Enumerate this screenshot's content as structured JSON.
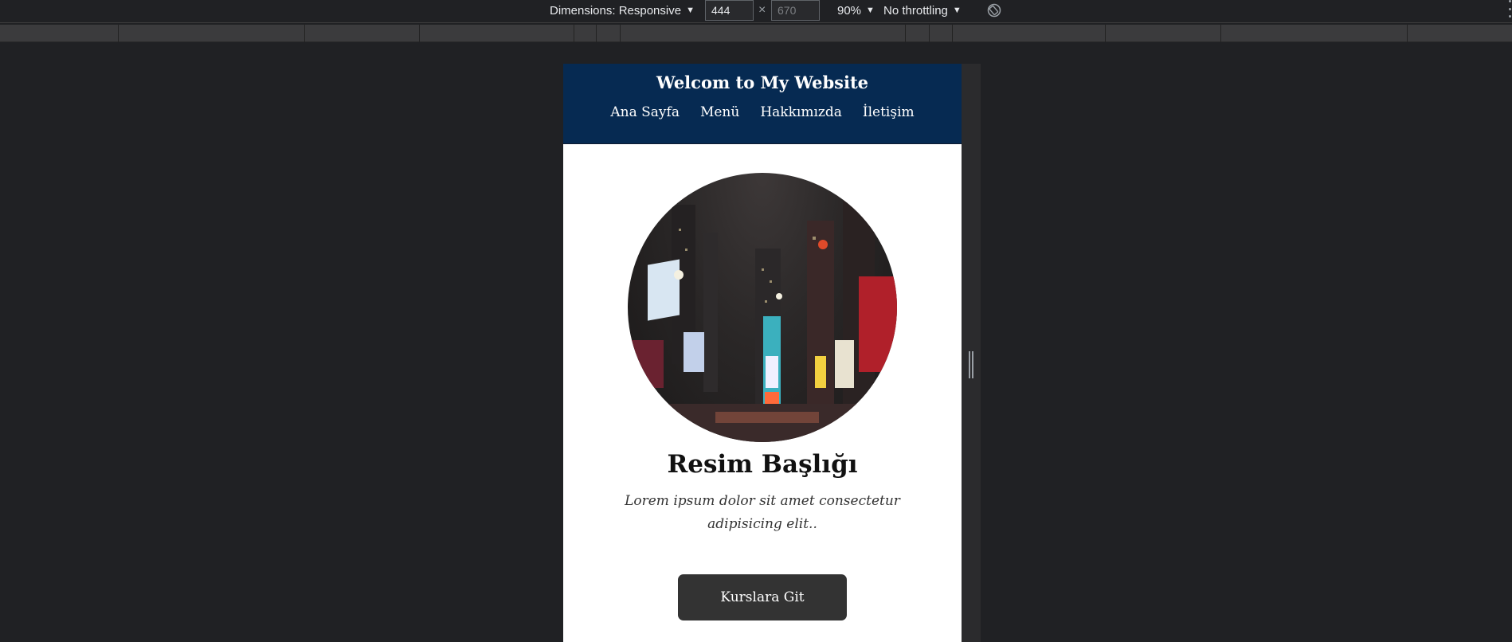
{
  "devtools": {
    "dimensions_label": "Dimensions: Responsive",
    "width_value": "444",
    "height_placeholder": "670",
    "times": "×",
    "zoom_label": "90%",
    "throttling_label": "No throttling",
    "caret": "▼"
  },
  "site": {
    "title": "Welcom to My Website",
    "nav": [
      "Ana Sayfa",
      "Menü",
      "Hakkımızda",
      "İletişim"
    ],
    "heading": "Resim Başlığı",
    "description": "Lorem ipsum dolor sit amet consectetur adipisicing elit..",
    "cta_label": "Kurslara Git"
  },
  "colors": {
    "header_bg": "#062a52",
    "button_bg": "#333333",
    "devtools_bg": "#202124"
  }
}
